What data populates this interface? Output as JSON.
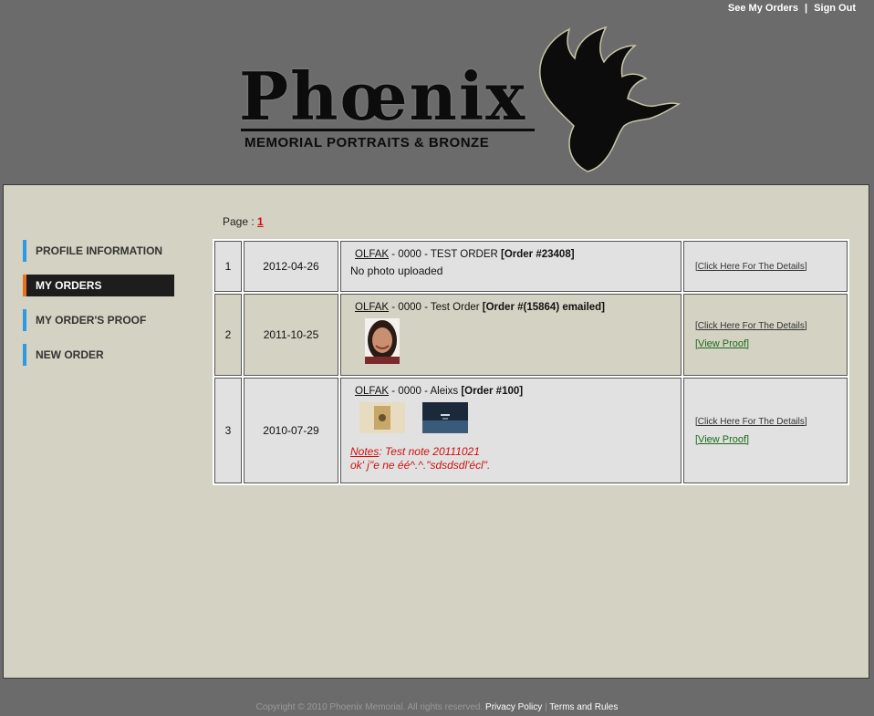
{
  "header": {
    "see_my_orders": "See My Orders",
    "separator": "|",
    "sign_out": "Sign Out",
    "logo_word": "Phœnix",
    "logo_subtitle": "MEMORIAL PORTRAITS & BRONZE"
  },
  "sidebar": {
    "items": [
      {
        "label": "PROFILE INFORMATION"
      },
      {
        "label": "MY ORDERS"
      },
      {
        "label": "MY ORDER'S PROOF"
      },
      {
        "label": "NEW ORDER"
      }
    ]
  },
  "pager": {
    "label": "Page :",
    "current": "1"
  },
  "orders": [
    {
      "num": "1",
      "date": "2012-04-26",
      "client": "OLFAK",
      "desc": " - 0000 - TEST ORDER ",
      "order": "[Order #23408]",
      "photo_note": "No photo uploaded",
      "details_label": "[Click Here For The Details]"
    },
    {
      "num": "2",
      "date": "2011-10-25",
      "client": "OLFAK",
      "desc": " - 0000 - Test Order ",
      "order": "[Order #(15864) emailed]",
      "details_label": "[Click Here For The Details]",
      "proof_label": "[View Proof]"
    },
    {
      "num": "3",
      "date": "2010-07-29",
      "client": "OLFAK",
      "desc": " - 0000 - Aleixs ",
      "order": "[Order #100]",
      "notes_label": "Notes",
      "notes_text": ": Test note 20111021",
      "notes_text2": "ok' j\"e ne éé^.^.\"sdsdsdl'écl\".",
      "details_label": "[Click Here For The Details]",
      "proof_label": "[View Proof]"
    }
  ],
  "footer": {
    "copyright": "Copyright © 2010 Phoenix Memorial. All rights reserved.",
    "privacy": "Privacy Policy",
    "separator": "|",
    "terms": "Terms and Rules"
  },
  "colors": {
    "background": "#6b6b6b",
    "content_bg": "#d3d2c3",
    "nav_accent": "#2c9be3",
    "nav_active_accent": "#e87020",
    "link_red": "#d01010",
    "proof_green": "#1e6a1e"
  }
}
